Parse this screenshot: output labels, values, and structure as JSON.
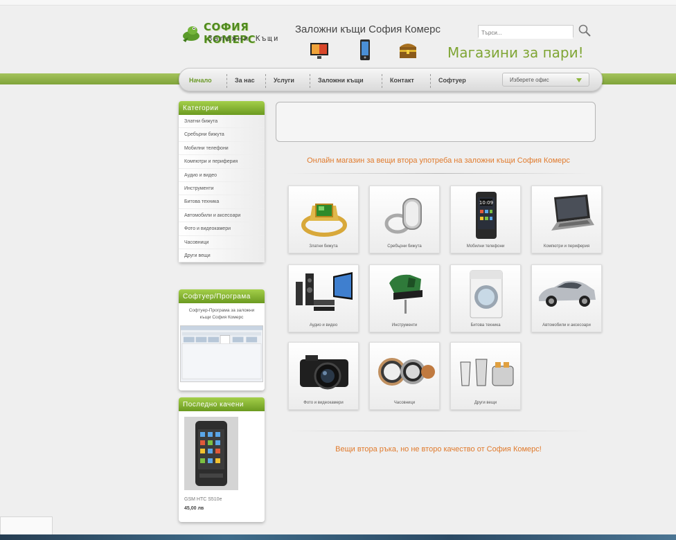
{
  "header": {
    "brand_name": "СОФИЯ КОМЕРС",
    "brand_sub": "Заложни Къщи",
    "site_title": "Заложни къщи София Комерс",
    "search_placeholder": "Търси...",
    "slogan": "Магазини за пари!",
    "icons": [
      "tv-icon",
      "phone-icon",
      "treasure-chest-icon"
    ]
  },
  "nav": {
    "items": [
      "Начало",
      "За нас",
      "Услуги",
      "Заложни къщи",
      "Контакт",
      "Софтуер"
    ],
    "office_select": "Изберете офис"
  },
  "sidebar": {
    "categories_title": "Категории",
    "categories": [
      "Златни бижута",
      "Сребърни бижута",
      "Мобилни телефони",
      "Компютри и периферия",
      "Аудио и видео",
      "Инструменти",
      "Битова техника",
      "Автомобили и аксесоари",
      "Фото и видеокамери",
      "Часовници",
      "Други вещи"
    ],
    "software_title": "Софтуер/Програма",
    "software_text": "Софтуер-Програма за заложни къщи София Комерс",
    "last_title": "Последно качени",
    "last_item_name": "GSM HTC S510e",
    "last_item_price": "45,00 лв"
  },
  "main": {
    "title": "Онлайн магазин за вещи втора употреба на заложни къщи София Комерс",
    "tiles": [
      {
        "label": "Златни бижута",
        "icon": "gold-ring-icon"
      },
      {
        "label": "Сребърни бижута",
        "icon": "silver-ring-icon"
      },
      {
        "label": "Мобилни телефони",
        "icon": "smartphone-icon"
      },
      {
        "label": "Компютри и периферия",
        "icon": "laptop-icon"
      },
      {
        "label": "Аудио и видео",
        "icon": "home-theater-icon"
      },
      {
        "label": "Инструменти",
        "icon": "jigsaw-icon"
      },
      {
        "label": "Битова техника",
        "icon": "washing-machine-icon"
      },
      {
        "label": "Автомобили и аксесоари",
        "icon": "car-icon"
      },
      {
        "label": "Фото и видеокамери",
        "icon": "camera-icon"
      },
      {
        "label": "Часовници",
        "icon": "watch-icon"
      },
      {
        "label": "Други вещи",
        "icon": "kitchen-appliances-icon"
      }
    ],
    "footer_slogan": "Вещи втора ръка, но не второ качество от София Комерс!"
  },
  "colors": {
    "brand_green": "#7fa534",
    "accent_orange": "#e07a2c",
    "panel_green": "#8bbd34"
  }
}
